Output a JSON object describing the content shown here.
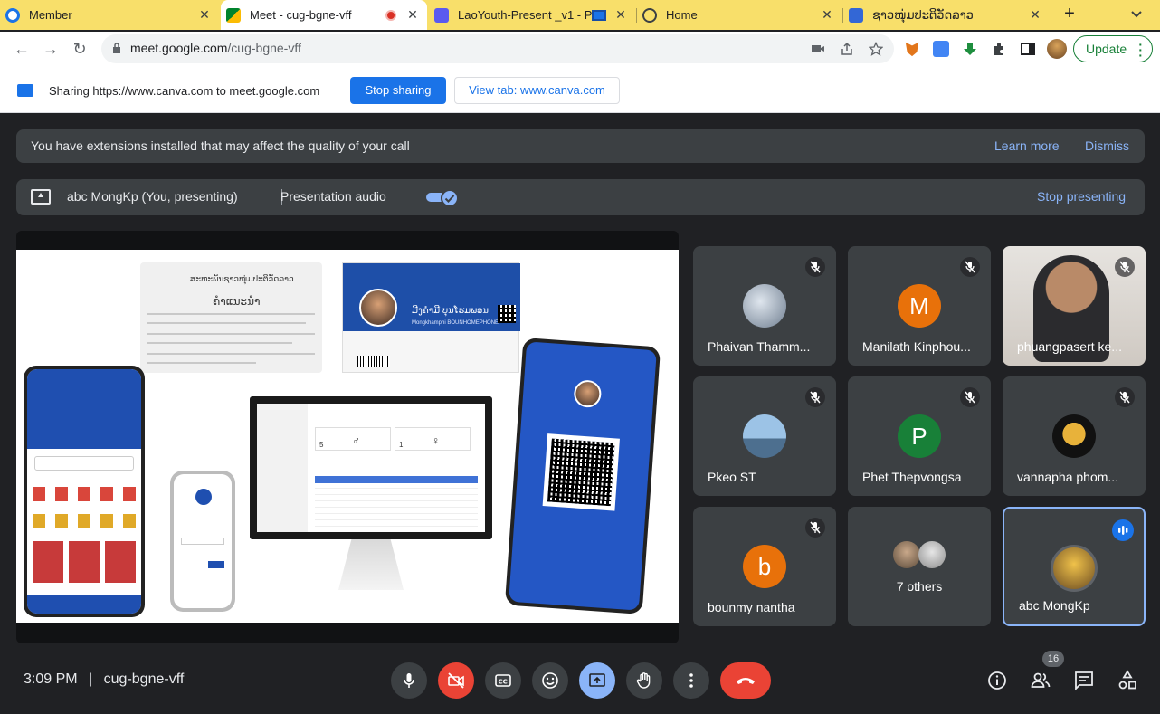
{
  "tabs": [
    {
      "title": "Member",
      "favicon_color": "#1a73e8"
    },
    {
      "title": "Meet - cug-bgne-vff",
      "favicon_color": "#00897b",
      "active": true
    },
    {
      "title": "LaoYouth-Present _v1 - P",
      "favicon_color": "#7b61ff"
    },
    {
      "title": "Home",
      "favicon_color": "#5f6368"
    },
    {
      "title": "ຊາວໜຸ່ມປະຕິວັດລາວ",
      "favicon_color": "#3367d6"
    }
  ],
  "new_tab": "+",
  "toolbar": {
    "url_domain": "meet.google.com",
    "url_path": "/cug-bgne-vff",
    "update_label": "Update"
  },
  "sharebar": {
    "text": "Sharing https://www.canva.com to meet.google.com",
    "stop_label": "Stop sharing",
    "view_label": "View tab: www.canva.com"
  },
  "banner": {
    "message": "You have extensions installed that may affect the quality of your call",
    "learn_more": "Learn more",
    "dismiss": "Dismiss"
  },
  "presenting": {
    "who": "abc MongKp (You, presenting)",
    "audio_label": "Presentation audio",
    "audio_on": true,
    "stop_label": "Stop presenting"
  },
  "participants": [
    {
      "name": "Phaivan Thamm...",
      "avatar": "photo",
      "color": "#b8c1c9",
      "muted": true
    },
    {
      "name": "Manilath Kinphou...",
      "avatar": "letter",
      "letter": "M",
      "color": "#e8710a",
      "muted": true
    },
    {
      "name": "phuangpasert ke...",
      "avatar": "video",
      "color": "#9aa0a6",
      "muted": true
    },
    {
      "name": "Pkeo ST",
      "avatar": "photo",
      "color": "#9cc3e6",
      "muted": true
    },
    {
      "name": "Phet Thepvongsa",
      "avatar": "letter",
      "letter": "P",
      "color": "#188038",
      "muted": true
    },
    {
      "name": "vannapha phom...",
      "avatar": "photo",
      "color": "#d4a017",
      "muted": true
    },
    {
      "name": "bounmy nantha",
      "avatar": "letter",
      "letter": "b",
      "color": "#e8710a",
      "muted": true
    },
    {
      "name": "7 others",
      "avatar": "group",
      "color": "#cfcfcf",
      "muted": false
    },
    {
      "name": "abc MongKp",
      "avatar": "photo",
      "color": "#c58a2b",
      "muted": false,
      "speaking": true
    }
  ],
  "bottom": {
    "time": "3:09 PM",
    "separator": "|",
    "meeting_code": "cug-bgne-vff",
    "people_count": "16"
  },
  "slide": {
    "card_title": "ຄຳແນະນຳ",
    "card_header": "ສະຫະພັນຊາວໜຸ່ມປະຕິວັດລາວ",
    "member_name": "ມີງຄຳມີ ບຸນໂຮມພອນ",
    "member_latin": "Mongkhamphi BOUNHOMEPHONE",
    "count_male": "5",
    "count_female": "1"
  }
}
